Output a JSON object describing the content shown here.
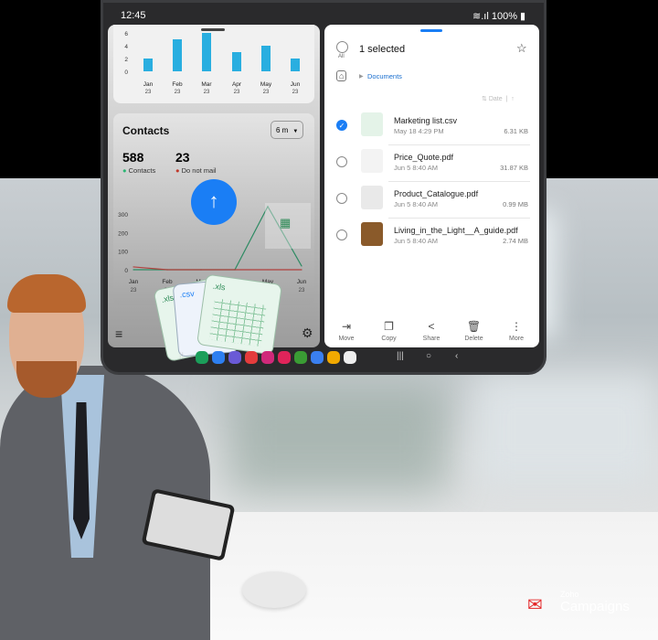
{
  "status": {
    "time": "12:45",
    "battery": "100%"
  },
  "left_pane": {
    "bar_chart": {
      "type": "bar",
      "categories": [
        "Jan 23",
        "Feb 23",
        "Mar 23",
        "Apr 23",
        "May 23",
        "Jun 23"
      ],
      "months": [
        "Jan",
        "Feb",
        "Mar",
        "Apr",
        "May",
        "Jun"
      ],
      "years": [
        "23",
        "23",
        "23",
        "23",
        "23",
        "23"
      ],
      "values": [
        2,
        5,
        6,
        3,
        4,
        2
      ],
      "yticks": [
        "0",
        "2",
        "4",
        "6"
      ],
      "ylim": [
        0,
        6
      ],
      "color": "#29aee0"
    },
    "contacts": {
      "title": "Contacts",
      "period": "6 m",
      "count": "588",
      "count_label": "Contacts",
      "dnm": "23",
      "dnm_label": "Do not mail",
      "contacts_color": "#2bb673",
      "dnm_color": "#c0392b"
    },
    "line_chart": {
      "type": "line",
      "months": [
        "Jan",
        "Feb",
        "Mar",
        "Apr",
        "May",
        "Jun"
      ],
      "years": [
        "23",
        "23",
        "23",
        "23",
        "23",
        "23"
      ],
      "yticks": [
        "0",
        "100",
        "200",
        "300"
      ],
      "ylim": [
        0,
        300
      ],
      "series": [
        {
          "values": [
            0,
            0,
            0,
            0,
            340,
            20
          ],
          "color": "#2e8b63"
        },
        {
          "values": [
            15,
            0,
            0,
            0,
            0,
            0
          ],
          "color": "#b0413e"
        }
      ]
    },
    "upload_color": "#1a7ef5",
    "file_cards": [
      ".xls",
      ".csv",
      ".xls"
    ]
  },
  "right_pane": {
    "all_label": "All",
    "selected": "1 selected",
    "breadcrumb": "Documents",
    "sort": "Date",
    "files": [
      {
        "name": "Marketing list.csv",
        "meta": "May 18 4:29 PM",
        "size": "6.31 KB",
        "checked": true
      },
      {
        "name": "Price_Quote.pdf",
        "meta": "Jun 5 8:40 AM",
        "size": "31.87 KB",
        "checked": false
      },
      {
        "name": "Product_Catalogue.pdf",
        "meta": "Jun 5 8:40 AM",
        "size": "0.99 MB",
        "checked": false
      },
      {
        "name": "Living_in_the_Light__A_guide.pdf",
        "meta": "Jun 5 8:40 AM",
        "size": "2.74 MB",
        "checked": false
      }
    ],
    "actions": [
      {
        "label": "Move",
        "icon": "move-icon"
      },
      {
        "label": "Copy",
        "icon": "copy-icon"
      },
      {
        "label": "Share",
        "icon": "share-icon"
      },
      {
        "label": "Delete",
        "icon": "trash-icon"
      },
      {
        "label": "More",
        "icon": "more-icon"
      }
    ]
  },
  "brand": {
    "logo_text": "Zoho",
    "product": "Campaigns"
  }
}
